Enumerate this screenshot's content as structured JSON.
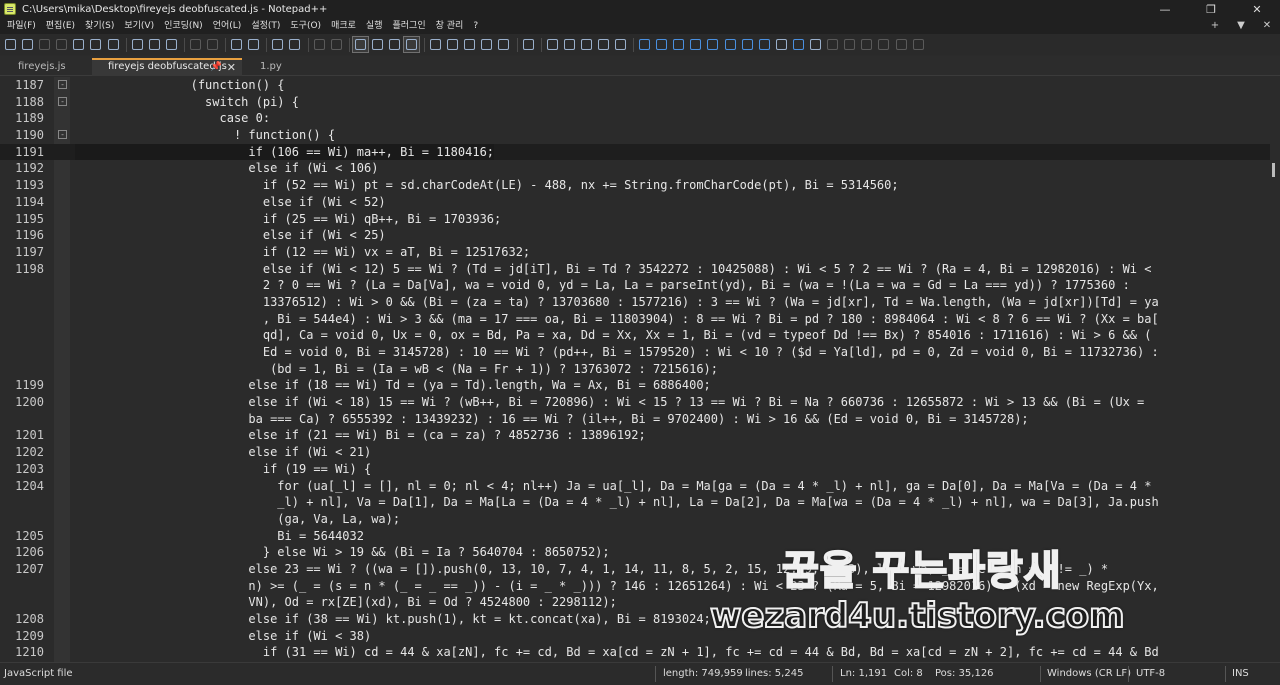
{
  "window": {
    "title": "C:\\Users\\mika\\Desktop\\fireyejs deobfuscated.js - Notepad++",
    "minimize": "—",
    "maximize": "❐",
    "close": "✕"
  },
  "menu": [
    {
      "label": "파일(F)"
    },
    {
      "label": "편집(E)"
    },
    {
      "label": "찾기(S)"
    },
    {
      "label": "보기(V)"
    },
    {
      "label": "인코딩(N)"
    },
    {
      "label": "언어(L)"
    },
    {
      "label": "설정(T)"
    },
    {
      "label": "도구(O)"
    },
    {
      "label": "매크로"
    },
    {
      "label": "실행"
    },
    {
      "label": "플러그인"
    },
    {
      "label": "창 관리"
    },
    {
      "label": "?"
    }
  ],
  "menu_right": {
    "plus": "+",
    "down": "▼",
    "close": "✕"
  },
  "tabs": [
    {
      "label": "fireyejs.js"
    },
    {
      "label": "fireyejs deobfuscated.js",
      "pin": "📌",
      "close": "✕"
    },
    {
      "label": "1.py"
    }
  ],
  "lines": [
    {
      "n": "1187",
      "fold": "-",
      "code": "                (function() {"
    },
    {
      "n": "1188",
      "fold": "-",
      "code": "                  switch (pi) {"
    },
    {
      "n": "1189",
      "fold": "",
      "code": "                    case 0:"
    },
    {
      "n": "1190",
      "fold": "-",
      "code": "                      ! function() {"
    },
    {
      "n": "1191",
      "fold": "",
      "code": "                        if (106 == Wi) ma++, Bi = 1180416;",
      "current": true
    },
    {
      "n": "1192",
      "fold": "",
      "code": "                        else if (Wi < 106)"
    },
    {
      "n": "1193",
      "fold": "",
      "code": "                          if (52 == Wi) pt = sd.charCodeAt(LE) - 488, nx += String.fromCharCode(pt), Bi = 5314560;"
    },
    {
      "n": "1194",
      "fold": "",
      "code": "                          else if (Wi < 52)"
    },
    {
      "n": "1195",
      "fold": "",
      "code": "                          if (25 == Wi) qB++, Bi = 1703936;"
    },
    {
      "n": "1196",
      "fold": "",
      "code": "                          else if (Wi < 25)"
    },
    {
      "n": "1197",
      "fold": "",
      "code": "                          if (12 == Wi) vx = aT, Bi = 12517632;"
    },
    {
      "n": "1198",
      "fold": "",
      "code": "                          else if (Wi < 12) 5 == Wi ? (Td = jd[iT], Bi = Td ? 3542272 : 10425088) : Wi < 5 ? 2 == Wi ? (Ra = 4, Bi = 12982016) : Wi <"
    },
    {
      "n": "",
      "fold": "",
      "code": "                          2 ? 0 == Wi ? (La = Da[Va], wa = void 0, yd = La, La = parseInt(yd), Bi = (wa = !(La = wa = Gd = La === yd)) ? 1775360 :"
    },
    {
      "n": "",
      "fold": "",
      "code": "                          13376512) : Wi > 0 && (Bi = (za = ta) ? 13703680 : 1577216) : 3 == Wi ? (Wa = jd[xr], Td = Wa.length, (Wa = jd[xr])[Td] = ya"
    },
    {
      "n": "",
      "fold": "",
      "code": "                          , Bi = 544e4) : Wi > 3 && (ma = 17 === oa, Bi = 11803904) : 8 == Wi ? Bi = pd ? 180 : 8984064 : Wi < 8 ? 6 == Wi ? (Xx = ba["
    },
    {
      "n": "",
      "fold": "",
      "code": "                          qd], Ca = void 0, Ux = 0, ox = Bd, Pa = xa, Dd = Xx, Xx = 1, Bi = (vd = typeof Dd !== Bx) ? 854016 : 1711616) : Wi > 6 && ("
    },
    {
      "n": "",
      "fold": "",
      "code": "                          Ed = void 0, Bi = 3145728) : 10 == Wi ? (pd++, Bi = 1579520) : Wi < 10 ? ($d = Ya[ld], pd = 0, Zd = void 0, Bi = 11732736) :"
    },
    {
      "n": "",
      "fold": "",
      "code": "                           (bd = 1, Bi = (Ia = wB < (Na = Fr + 1)) ? 13763072 : 7215616);"
    },
    {
      "n": "1199",
      "fold": "",
      "code": "                        else if (18 == Wi) Td = (ya = Td).length, Wa = Ax, Bi = 6886400;"
    },
    {
      "n": "1200",
      "fold": "",
      "code": "                        else if (Wi < 18) 15 == Wi ? (wB++, Bi = 720896) : Wi < 15 ? 13 == Wi ? Bi = Na ? 660736 : 12655872 : Wi > 13 && (Bi = (Ux ="
    },
    {
      "n": "",
      "fold": "",
      "code": "                        ba === Ca) ? 6555392 : 13439232) : 16 == Wi ? (il++, Bi = 9702400) : Wi > 16 && (Ed = void 0, Bi = 3145728);"
    },
    {
      "n": "1201",
      "fold": "",
      "code": "                        else if (21 == Wi) Bi = (ca = za) ? 4852736 : 13896192;"
    },
    {
      "n": "1202",
      "fold": "",
      "code": "                        else if (Wi < 21)"
    },
    {
      "n": "1203",
      "fold": "",
      "code": "                          if (19 == Wi) {"
    },
    {
      "n": "1204",
      "fold": "",
      "code": "                            for (ua[_l] = [], nl = 0; nl < 4; nl++) Ja = ua[_l], Da = Ma[ga = (Da = 4 * _l) + nl], ga = Da[0], Da = Ma[Va = (Da = 4 *"
    },
    {
      "n": "",
      "fold": "",
      "code": "                            _l) + nl], Va = Da[1], Da = Ma[La = (Da = 4 * _l) + nl], La = Da[2], Da = Ma[wa = (Da = 4 * _l) + nl], wa = Da[3], Ja.push"
    },
    {
      "n": "",
      "fold": "",
      "code": "                            (ga, Va, La, wa);"
    },
    {
      "n": "1205",
      "fold": "",
      "code": "                            Bi = 5644032"
    },
    {
      "n": "1206",
      "fold": "",
      "code": "                          } else Wi > 19 && (Bi = Ia ? 5640704 : 8650752);"
    },
    {
      "n": "1207",
      "fold": "",
      "code": "                        else 23 == Wi ? ((wa = []).push(0, 13, 10, 7, 4, 1, 14, 11, 8, 5, 2, 15, 12, 9, 6, 3), ll = wa, _ = (e = (n = s != _) *"
    },
    {
      "n": "",
      "fold": "",
      "code": "                        n) >= (_ = (s = n * (_ = _ == _)) - (i = _ * _))) ? 146 : 12651264) : Wi < 23 ? (Ra = 5, Bi = 12982016) : (xd = new RegExp(Yx,"
    },
    {
      "n": "",
      "fold": "",
      "code": "                        VN), Od = rx[ZE](xd), Bi = Od ? 4524800 : 2298112);"
    },
    {
      "n": "1208",
      "fold": "",
      "code": "                        else if (38 == Wi) kt.push(1), kt = kt.concat(xa), Bi = 8193024;"
    },
    {
      "n": "1209",
      "fold": "",
      "code": "                        else if (Wi < 38)"
    },
    {
      "n": "1210",
      "fold": "",
      "code": "                          if (31 == Wi) cd = 44 & xa[zN], fc += cd, Bd = xa[cd = zN + 1], fc += cd = 44 & Bd, Bd = xa[cd = zN + 2], fc += cd = 44 & Bd"
    }
  ],
  "watermark": {
    "line1": "꿈을 꾸는파랑새",
    "line2": "wezard4u.tistory.com"
  },
  "status": {
    "file_type": "JavaScript file",
    "length": "length: 749,959",
    "lines": "lines: 5,245",
    "ln": "Ln: 1,191",
    "col": "Col: 8",
    "pos": "Pos: 35,126",
    "eol": "Windows (CR LF)",
    "encoding": "UTF-8",
    "ins": "INS"
  }
}
